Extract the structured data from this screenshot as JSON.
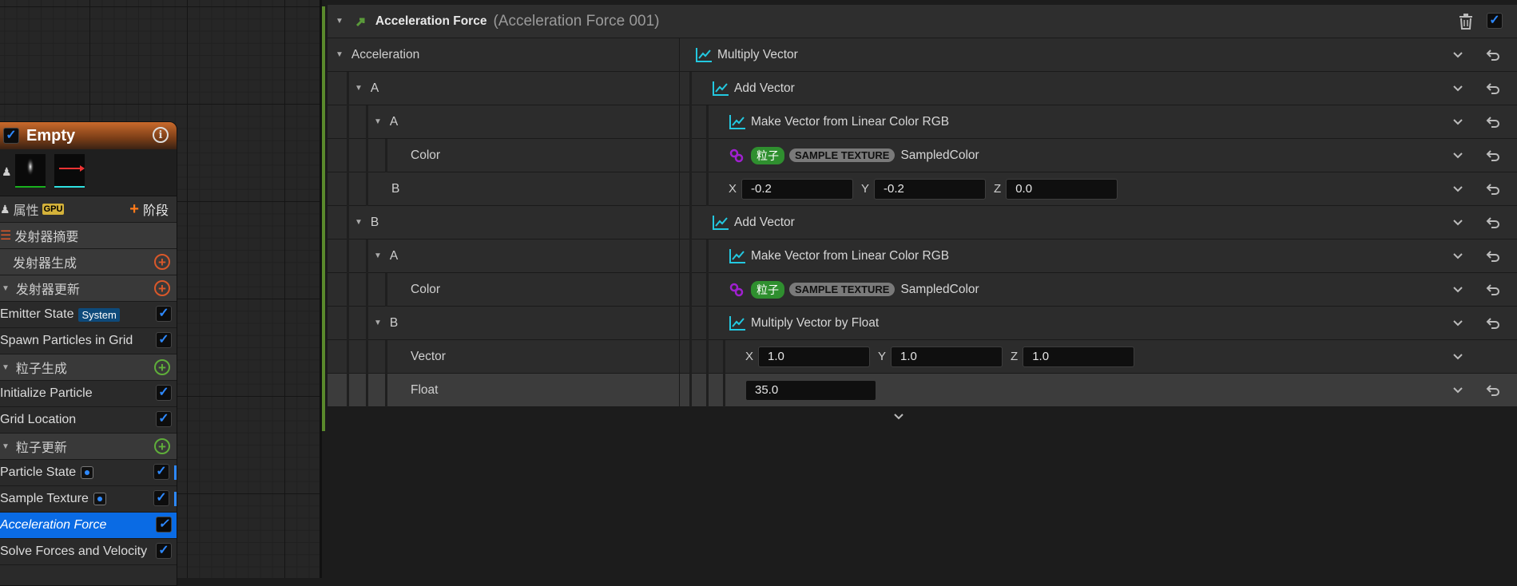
{
  "colors": {
    "accent_blue": "#0a6be4",
    "node_header": "#c96a2c",
    "graph_icon": "#23c8e0",
    "link_icon": "#a020d0",
    "green_tag": "#2f8f2f",
    "orange_plus": "#d9582a",
    "green_plus": "#5fae3a"
  },
  "node": {
    "title": "Empty",
    "tabs": {
      "properties": "属性",
      "gpu_badge": "GPU",
      "stage": "阶段"
    },
    "sections": {
      "emitter_summary": "发射器摘要",
      "emitter_spawn": "发射器生成",
      "emitter_update": "发射器更新",
      "particle_spawn": "粒子生成",
      "particle_update": "粒子更新"
    },
    "modules": {
      "emitter_state": "Emitter State",
      "emitter_state_badge": "System",
      "spawn_grid": "Spawn Particles in Grid",
      "init_particle": "Initialize Particle",
      "grid_location": "Grid Location",
      "particle_state": "Particle State",
      "sample_texture": "Sample Texture",
      "accel_force": "Acceleration Force",
      "solve_forces": "Solve Forces and Velocity"
    }
  },
  "details": {
    "header": {
      "title": "Acceleration Force",
      "subtitle": "(Acceleration Force 001)"
    },
    "rows": [
      {
        "label": "Acceleration",
        "value": "Multiply Vector"
      },
      {
        "label": "A",
        "value": "Add Vector"
      },
      {
        "label": "A",
        "value": "Make Vector from Linear Color RGB"
      },
      {
        "label": "Color",
        "tag1": "粒子",
        "tag2": "SAMPLE TEXTURE",
        "value": "SampledColor"
      },
      {
        "label": "B",
        "x_label": "X",
        "x": "-0.2",
        "y_label": "Y",
        "y": "-0.2",
        "z_label": "Z",
        "z": "0.0"
      },
      {
        "label": "B",
        "value": "Add Vector"
      },
      {
        "label": "A",
        "value": "Make Vector from Linear Color RGB"
      },
      {
        "label": "Color",
        "tag1": "粒子",
        "tag2": "SAMPLE TEXTURE",
        "value": "SampledColor"
      },
      {
        "label": "B",
        "value": "Multiply Vector by Float"
      },
      {
        "label": "Vector",
        "x_label": "X",
        "x": "1.0",
        "y_label": "Y",
        "y": "1.0",
        "z_label": "Z",
        "z": "1.0"
      },
      {
        "label": "Float",
        "value": "35.0"
      }
    ]
  }
}
